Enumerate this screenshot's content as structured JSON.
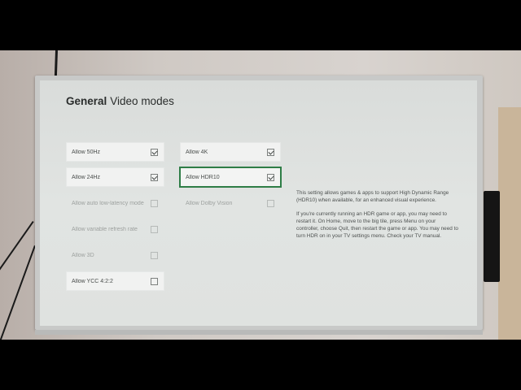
{
  "header": {
    "section": "General",
    "title": "Video modes"
  },
  "options": {
    "allow_50hz": {
      "label": "Allow 50Hz",
      "checked": true,
      "enabled": true
    },
    "allow_24hz": {
      "label": "Allow 24Hz",
      "checked": true,
      "enabled": true
    },
    "allow_low_latency": {
      "label": "Allow auto low-latency mode",
      "checked": false,
      "enabled": false
    },
    "allow_vrr": {
      "label": "Allow variable refresh rate",
      "checked": false,
      "enabled": false
    },
    "allow_3d": {
      "label": "Allow 3D",
      "checked": false,
      "enabled": false
    },
    "allow_ycc": {
      "label": "Allow YCC 4:2:2",
      "checked": false,
      "enabled": true
    },
    "allow_4k": {
      "label": "Allow 4K",
      "checked": true,
      "enabled": true
    },
    "allow_hdr10": {
      "label": "Allow HDR10",
      "checked": true,
      "enabled": true,
      "focused": true
    },
    "allow_dolby_vision": {
      "label": "Allow Dolby Vision",
      "checked": false,
      "enabled": false
    }
  },
  "description": {
    "paragraph1": "This setting allows games & apps to support High Dynamic Range (HDR10) when available, for an enhanced visual experience.",
    "paragraph2": "If you're currently running an HDR game or app, you may need to restart it. On Home, move to the big tile, press Menu on your controller, choose Quit, then restart the game or app. You may need to turn HDR on in your TV settings menu. Check your TV manual."
  },
  "colors": {
    "focus_accent": "#2e7d46",
    "screen_bg": "#dfe2e0",
    "tile_bg": "#f1f2f1"
  }
}
